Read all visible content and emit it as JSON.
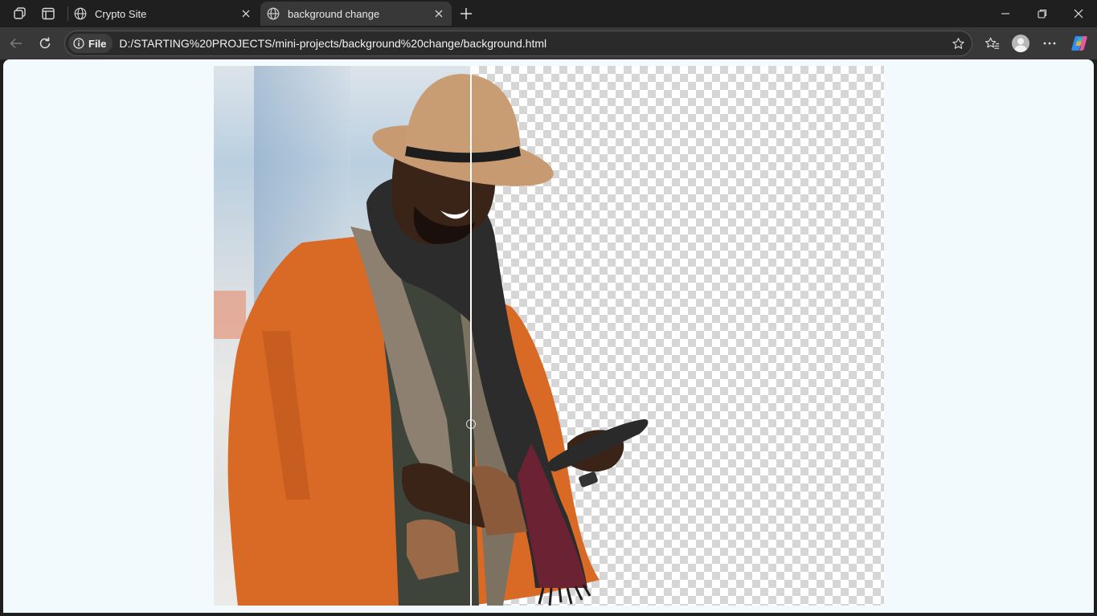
{
  "browser": {
    "tabs": [
      {
        "title": "Crypto Site",
        "active": false
      },
      {
        "title": "background change",
        "active": true
      }
    ],
    "address_bar": {
      "scheme_chip": "File",
      "url": "D:/STARTING%20PROJECTS/mini-projects/background%20change/background.html"
    },
    "icons": {
      "workspaces": "workspaces-icon",
      "tab_actions": "vertical-tabs-icon",
      "favicon": "globe-icon",
      "close_tab": "close-icon",
      "new_tab": "plus-icon",
      "back": "back-arrow-icon",
      "refresh": "refresh-icon",
      "info": "info-icon",
      "favorite": "star-icon",
      "favorites": "favorites-icon",
      "profile": "avatar-icon",
      "more": "ellipsis-icon",
      "copilot": "copilot-icon",
      "minimize": "minimize-icon",
      "restore": "restore-icon",
      "close_window": "close-icon"
    }
  },
  "page": {
    "background_color": "#f3fafe",
    "comparison": {
      "left_side": "original photo with street background",
      "right_side": "background removed (transparent checkerboard)",
      "divider_position": 0.384
    }
  }
}
